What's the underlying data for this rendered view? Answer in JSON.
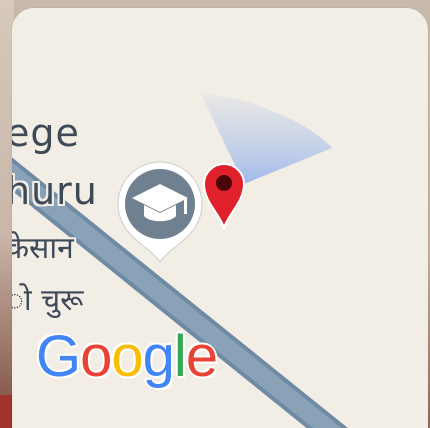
{
  "map": {
    "labels": {
      "line1": "ege",
      "line2": "huru",
      "line3": "केसान",
      "line4": "ो चुरू"
    },
    "attribution": {
      "letters": [
        "G",
        "o",
        "o",
        "g",
        "l",
        "e"
      ],
      "colors": [
        "#4285F4",
        "#EA4335",
        "#FBBC05",
        "#4285F4",
        "#34A853",
        "#EA4335"
      ]
    },
    "school_marker": {
      "icon": "graduation-cap-icon",
      "color": "#6f8190"
    },
    "location_marker": {
      "icon": "location-pin-icon",
      "color": "#e0202a"
    },
    "colors": {
      "land": "#f3eee5",
      "road": "#7d97ad",
      "heading_beam": "#5b8ef0"
    }
  }
}
